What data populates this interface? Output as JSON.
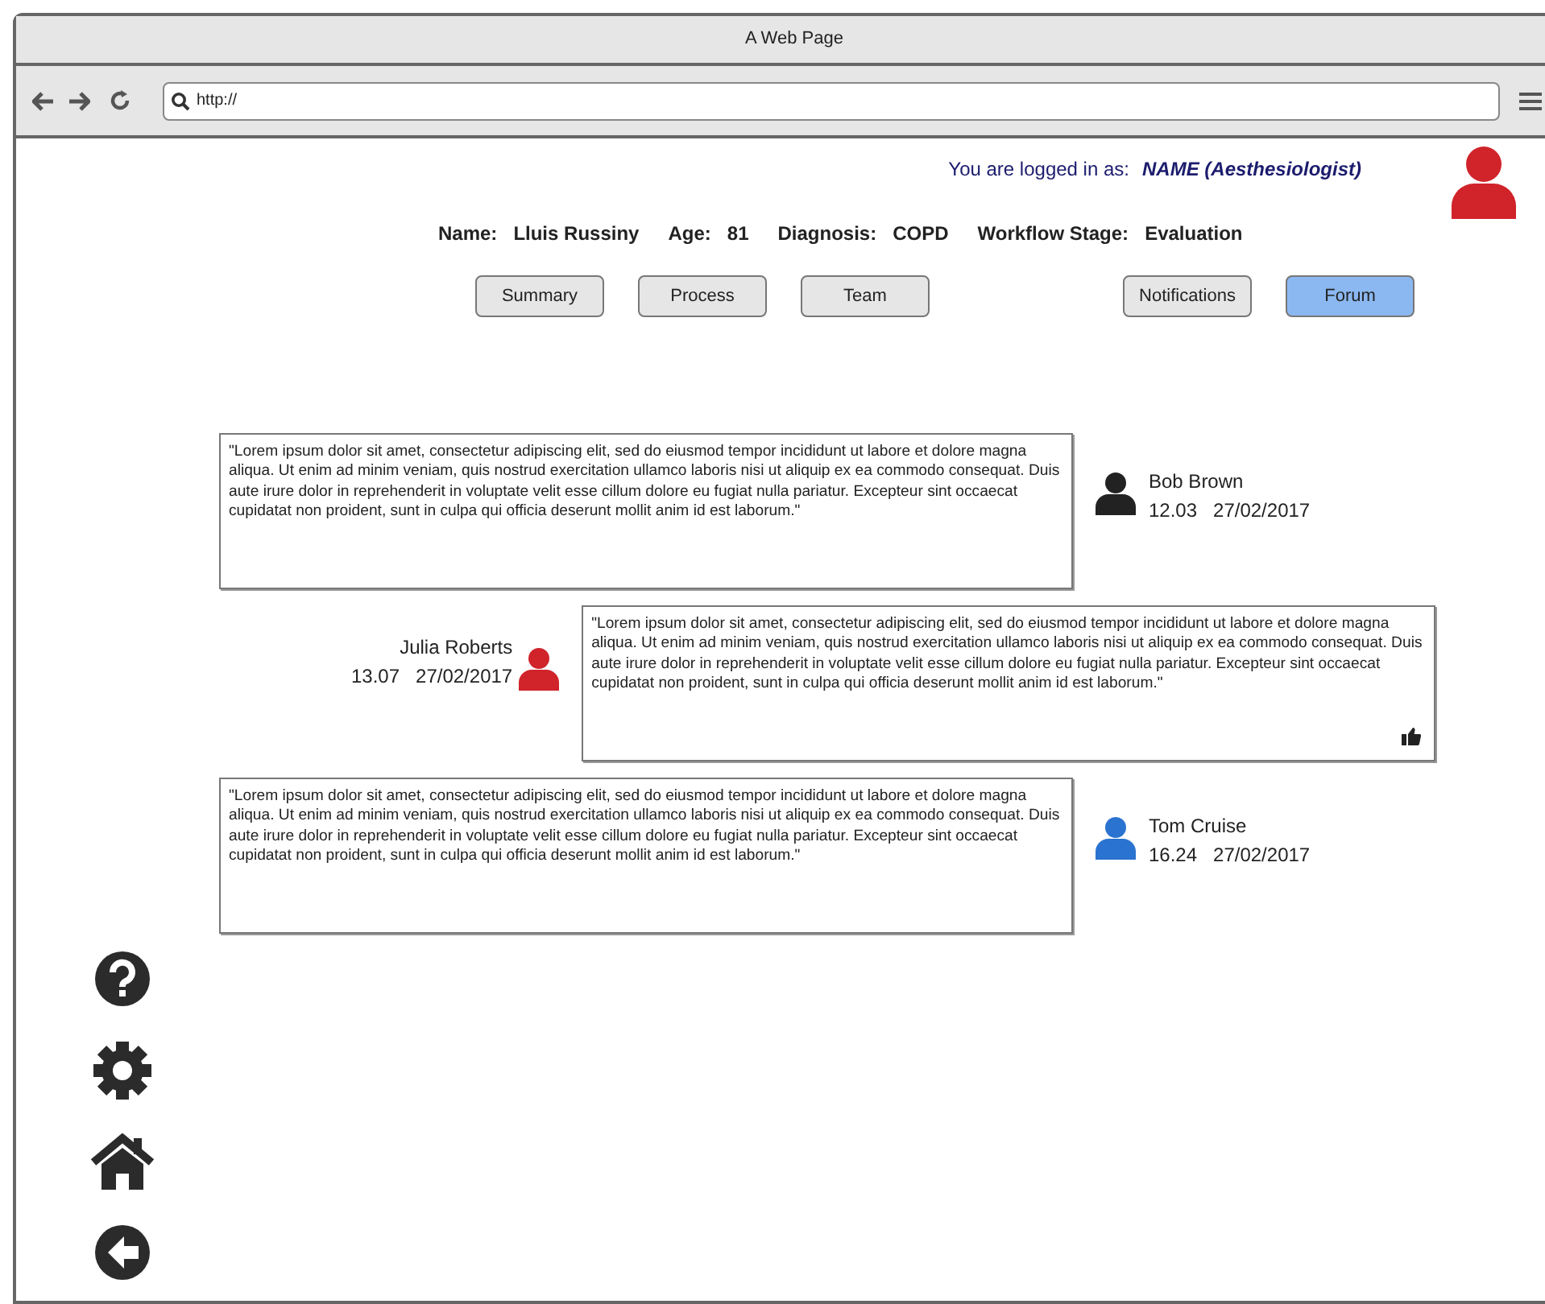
{
  "window": {
    "title": "A Web Page"
  },
  "address_bar": {
    "url": "http://"
  },
  "login": {
    "label": "You are logged in as:",
    "user": "NAME (Aesthesiologist)"
  },
  "patient": [
    {
      "label": "Name:",
      "value": "Lluis Russiny"
    },
    {
      "label": "Age:",
      "value": "81"
    },
    {
      "label": "Diagnosis:",
      "value": "COPD"
    },
    {
      "label": "Workflow Stage:",
      "value": "Evaluation"
    }
  ],
  "tabs": [
    {
      "label": "Summary",
      "selected": false
    },
    {
      "label": "Process",
      "selected": false
    },
    {
      "label": "Team",
      "selected": false
    }
  ],
  "secondary_tabs": [
    {
      "label": "Notifications",
      "selected": false
    },
    {
      "label": "Forum",
      "selected": true
    }
  ],
  "comments": [
    {
      "kind": "left",
      "text": "\"Lorem ipsum dolor sit amet, consectetur adipiscing elit, sed do eiusmod tempor incididunt ut labore et dolore magna aliqua. Ut enim ad minim veniam, quis nostrud exercitation ullamco laboris nisi ut aliquip ex ea commodo consequat. Duis aute irure dolor in reprehenderit in voluptate velit esse cillum dolore eu fugiat nulla pariatur. Excepteur sint occaecat cupidatat non proident, sunt in culpa qui officia deserunt mollit anim id est laborum.\"",
      "author": "Bob Brown",
      "time": "12.03",
      "date": "27/02/2017",
      "color": "#222222",
      "liked": false
    },
    {
      "kind": "right",
      "text": "\"Lorem ipsum dolor sit amet, consectetur adipiscing elit, sed do eiusmod tempor incididunt ut labore et dolore magna aliqua. Ut enim ad minim veniam, quis nostrud exercitation ullamco laboris nisi ut aliquip ex ea commodo consequat. Duis aute irure dolor in reprehenderit in voluptate velit esse cillum dolore eu fugiat nulla pariatur. Excepteur sint occaecat cupidatat non proident, sunt in culpa qui officia deserunt mollit anim id est laborum.\"",
      "author": "Julia Roberts",
      "time": "13.07",
      "date": "27/02/2017",
      "color": "#d0232a",
      "liked": true
    },
    {
      "kind": "left",
      "text": "\"Lorem ipsum dolor sit amet, consectetur adipiscing elit, sed do eiusmod tempor incididunt ut labore et dolore magna aliqua. Ut enim ad minim veniam, quis nostrud exercitation ullamco laboris nisi ut aliquip ex ea commodo consequat. Duis aute irure dolor in reprehenderit in voluptate velit esse cillum dolore eu fugiat nulla pariatur. Excepteur sint occaecat cupidatat non proident, sunt in culpa qui officia deserunt mollit anim id est laborum.\"",
      "author": "Tom Cruise",
      "time": "16.24",
      "date": "27/02/2017",
      "color": "#2a73d0",
      "liked": false
    }
  ]
}
